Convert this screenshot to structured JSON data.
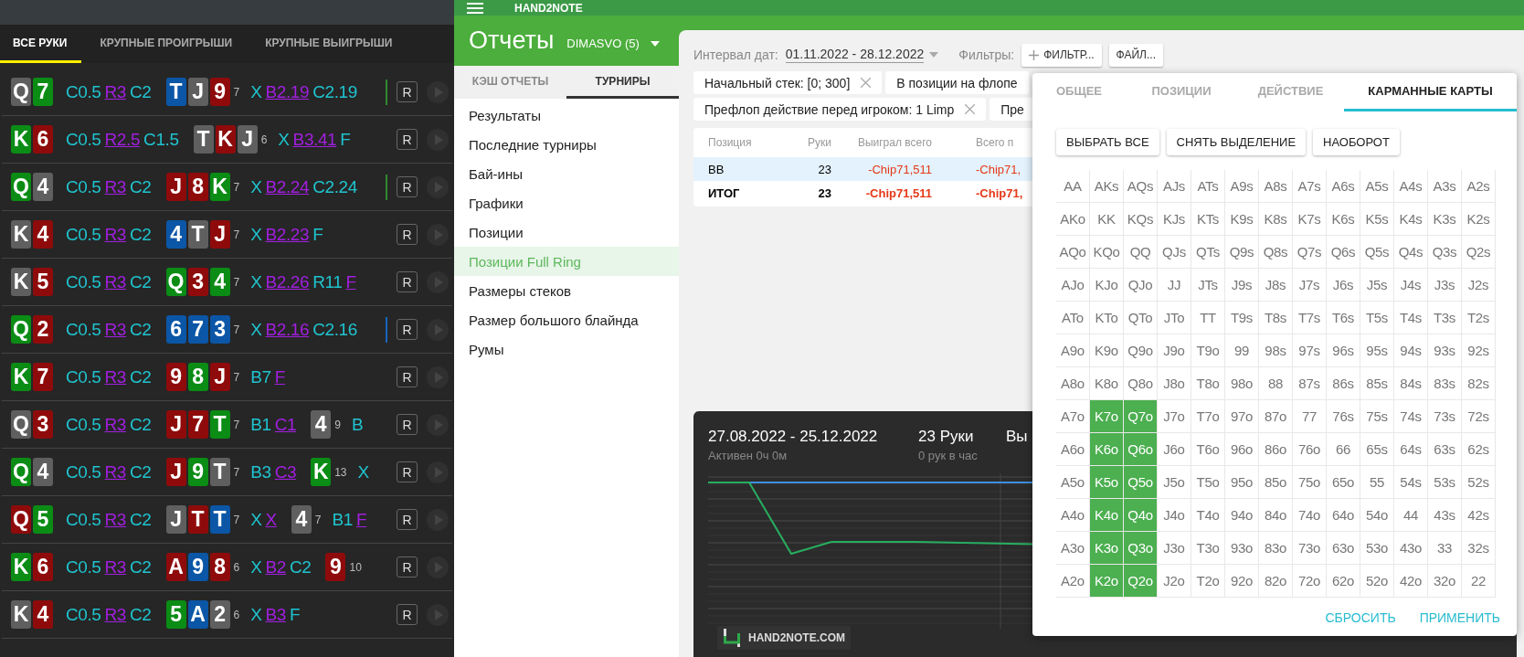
{
  "hands_panel": {
    "tabs": [
      {
        "label": "ВСЕ РУКИ",
        "selected": true
      },
      {
        "label": "КРУПНЫЕ ПРОИГРЫШИ",
        "selected": false
      },
      {
        "label": "КРУПНЫЕ ВЫИГРЫШИ",
        "selected": false
      }
    ],
    "hands": [
      {
        "hole": [
          {
            "rank": "Q",
            "color": "#5f5f5f"
          },
          {
            "rank": "7",
            "color": "#0b8c15"
          }
        ],
        "preflop": [
          {
            "text": "C0.5",
            "hero": false
          },
          {
            "text": "R3",
            "hero": true
          },
          {
            "text": "C2",
            "hero": false
          }
        ],
        "streets": [
          {
            "cards": [
              {
                "rank": "T",
                "color": "#0b56a6"
              },
              {
                "rank": "J",
                "color": "#5f5f5f"
              },
              {
                "rank": "9",
                "color": "#8f0b0b"
              }
            ],
            "pot": "7",
            "actions": [
              {
                "text": "X",
                "hero": false
              },
              {
                "text": "B2.19",
                "hero": true
              },
              {
                "text": "C2.19",
                "hero": false
              }
            ]
          }
        ],
        "marker": {
          "color": "#2e8b2e"
        },
        "replay": "R"
      },
      {
        "hole": [
          {
            "rank": "K",
            "color": "#0b8c15"
          },
          {
            "rank": "6",
            "color": "#8f0b0b"
          }
        ],
        "preflop": [
          {
            "text": "C0.5",
            "hero": false
          },
          {
            "text": "R2.5",
            "hero": true
          },
          {
            "text": "C1.5",
            "hero": false
          }
        ],
        "streets": [
          {
            "cards": [
              {
                "rank": "T",
                "color": "#5f5f5f"
              },
              {
                "rank": "K",
                "color": "#8f0b0b"
              },
              {
                "rank": "J",
                "color": "#5f5f5f"
              }
            ],
            "pot": "6",
            "actions": [
              {
                "text": "X",
                "hero": false
              },
              {
                "text": "B3.41",
                "hero": true
              },
              {
                "text": "F",
                "hero": false
              }
            ]
          }
        ],
        "replay": "R"
      },
      {
        "hole": [
          {
            "rank": "Q",
            "color": "#0b8c15"
          },
          {
            "rank": "4",
            "color": "#5f5f5f"
          }
        ],
        "preflop": [
          {
            "text": "C0.5",
            "hero": false
          },
          {
            "text": "R3",
            "hero": true
          },
          {
            "text": "C2",
            "hero": false
          }
        ],
        "streets": [
          {
            "cards": [
              {
                "rank": "J",
                "color": "#8f0b0b"
              },
              {
                "rank": "8",
                "color": "#8f0b0b"
              },
              {
                "rank": "K",
                "color": "#0b8c15"
              }
            ],
            "pot": "7",
            "actions": [
              {
                "text": "X",
                "hero": false
              },
              {
                "text": "B2.24",
                "hero": true
              },
              {
                "text": "C2.24",
                "hero": false
              }
            ]
          }
        ],
        "marker": {
          "color": "#2e8b2e"
        },
        "replay": "R"
      },
      {
        "hole": [
          {
            "rank": "K",
            "color": "#5f5f5f"
          },
          {
            "rank": "4",
            "color": "#8f0b0b"
          }
        ],
        "preflop": [
          {
            "text": "C0.5",
            "hero": false
          },
          {
            "text": "R3",
            "hero": true
          },
          {
            "text": "C2",
            "hero": false
          }
        ],
        "streets": [
          {
            "cards": [
              {
                "rank": "4",
                "color": "#0b56a6"
              },
              {
                "rank": "T",
                "color": "#5f5f5f"
              },
              {
                "rank": "J",
                "color": "#8f0b0b"
              }
            ],
            "pot": "7",
            "actions": [
              {
                "text": "X",
                "hero": false
              },
              {
                "text": "B2.23",
                "hero": true
              },
              {
                "text": "F",
                "hero": false
              }
            ]
          }
        ],
        "replay": "R"
      },
      {
        "hole": [
          {
            "rank": "K",
            "color": "#5f5f5f"
          },
          {
            "rank": "5",
            "color": "#8f0b0b"
          }
        ],
        "preflop": [
          {
            "text": "C0.5",
            "hero": false
          },
          {
            "text": "R3",
            "hero": true
          },
          {
            "text": "C2",
            "hero": false
          }
        ],
        "streets": [
          {
            "cards": [
              {
                "rank": "Q",
                "color": "#0b8c15"
              },
              {
                "rank": "3",
                "color": "#8f0b0b"
              },
              {
                "rank": "4",
                "color": "#0b8c15"
              }
            ],
            "pot": "7",
            "actions": [
              {
                "text": "X",
                "hero": false
              },
              {
                "text": "B2.26",
                "hero": true
              },
              {
                "text": "R11",
                "hero": false
              },
              {
                "text": "F",
                "hero": true
              }
            ]
          }
        ],
        "replay": "R"
      },
      {
        "hole": [
          {
            "rank": "Q",
            "color": "#0b8c15"
          },
          {
            "rank": "2",
            "color": "#8f0b0b"
          }
        ],
        "preflop": [
          {
            "text": "C0.5",
            "hero": false
          },
          {
            "text": "R3",
            "hero": true
          },
          {
            "text": "C2",
            "hero": false
          }
        ],
        "streets": [
          {
            "cards": [
              {
                "rank": "6",
                "color": "#0b56a6"
              },
              {
                "rank": "7",
                "color": "#0b56a6"
              },
              {
                "rank": "3",
                "color": "#0b56a6"
              }
            ],
            "pot": "7",
            "actions": [
              {
                "text": "X",
                "hero": false
              },
              {
                "text": "B2.16",
                "hero": true
              },
              {
                "text": "C2.16",
                "hero": false
              }
            ]
          }
        ],
        "marker": {
          "color": "#1565c0"
        },
        "replay": "R"
      },
      {
        "hole": [
          {
            "rank": "K",
            "color": "#0b8c15"
          },
          {
            "rank": "7",
            "color": "#8f0b0b"
          }
        ],
        "preflop": [
          {
            "text": "C0.5",
            "hero": false
          },
          {
            "text": "R3",
            "hero": true
          },
          {
            "text": "C2",
            "hero": false
          }
        ],
        "streets": [
          {
            "cards": [
              {
                "rank": "9",
                "color": "#8f0b0b"
              },
              {
                "rank": "8",
                "color": "#0b8c15"
              },
              {
                "rank": "J",
                "color": "#8f0b0b"
              }
            ],
            "pot": "7",
            "actions": [
              {
                "text": "B7",
                "hero": false
              },
              {
                "text": "F",
                "hero": true
              }
            ]
          }
        ],
        "replay": "R"
      },
      {
        "hole": [
          {
            "rank": "Q",
            "color": "#5f5f5f"
          },
          {
            "rank": "3",
            "color": "#8f0b0b"
          }
        ],
        "preflop": [
          {
            "text": "C0.5",
            "hero": false
          },
          {
            "text": "R3",
            "hero": true
          },
          {
            "text": "C2",
            "hero": false
          }
        ],
        "streets": [
          {
            "cards": [
              {
                "rank": "J",
                "color": "#8f0b0b"
              },
              {
                "rank": "7",
                "color": "#8f0b0b"
              },
              {
                "rank": "T",
                "color": "#0b8c15"
              }
            ],
            "pot": "7",
            "actions": [
              {
                "text": "B1",
                "hero": false
              },
              {
                "text": "C1",
                "hero": true
              }
            ]
          },
          {
            "cards": [
              {
                "rank": "4",
                "color": "#5f5f5f"
              }
            ],
            "pot": "9",
            "actions": [
              {
                "text": "B",
                "hero": false
              }
            ]
          }
        ],
        "replay": "R"
      },
      {
        "hole": [
          {
            "rank": "Q",
            "color": "#0b8c15"
          },
          {
            "rank": "4",
            "color": "#5f5f5f"
          }
        ],
        "preflop": [
          {
            "text": "C0.5",
            "hero": false
          },
          {
            "text": "R3",
            "hero": true
          },
          {
            "text": "C2",
            "hero": false
          }
        ],
        "streets": [
          {
            "cards": [
              {
                "rank": "J",
                "color": "#8f0b0b"
              },
              {
                "rank": "9",
                "color": "#0b8c15"
              },
              {
                "rank": "T",
                "color": "#5f5f5f"
              }
            ],
            "pot": "7",
            "actions": [
              {
                "text": "B3",
                "hero": false
              },
              {
                "text": "C3",
                "hero": true
              }
            ]
          },
          {
            "cards": [
              {
                "rank": "K",
                "color": "#0b8c15"
              }
            ],
            "pot": "13",
            "actions": [
              {
                "text": "X",
                "hero": false
              }
            ]
          }
        ],
        "replay": "R"
      },
      {
        "hole": [
          {
            "rank": "Q",
            "color": "#8f0b0b"
          },
          {
            "rank": "5",
            "color": "#0b8c15"
          }
        ],
        "preflop": [
          {
            "text": "C0.5",
            "hero": false
          },
          {
            "text": "R3",
            "hero": true
          },
          {
            "text": "C2",
            "hero": false
          }
        ],
        "streets": [
          {
            "cards": [
              {
                "rank": "J",
                "color": "#5f5f5f"
              },
              {
                "rank": "T",
                "color": "#8f0b0b"
              },
              {
                "rank": "T",
                "color": "#0b56a6"
              }
            ],
            "pot": "7",
            "actions": [
              {
                "text": "X",
                "hero": false
              },
              {
                "text": "X",
                "hero": true
              }
            ]
          },
          {
            "cards": [
              {
                "rank": "4",
                "color": "#5f5f5f"
              }
            ],
            "pot": "7",
            "actions": [
              {
                "text": "B1",
                "hero": false
              },
              {
                "text": "F",
                "hero": true
              }
            ]
          }
        ],
        "replay": "R"
      },
      {
        "hole": [
          {
            "rank": "K",
            "color": "#0b8c15"
          },
          {
            "rank": "6",
            "color": "#8f0b0b"
          }
        ],
        "preflop": [
          {
            "text": "C0.5",
            "hero": false
          },
          {
            "text": "R3",
            "hero": true
          },
          {
            "text": "C2",
            "hero": false
          }
        ],
        "streets": [
          {
            "cards": [
              {
                "rank": "A",
                "color": "#8f0b0b"
              },
              {
                "rank": "9",
                "color": "#0b56a6"
              },
              {
                "rank": "8",
                "color": "#8f0b0b"
              }
            ],
            "pot": "6",
            "actions": [
              {
                "text": "X",
                "hero": false
              },
              {
                "text": "B2",
                "hero": true
              },
              {
                "text": "C2",
                "hero": false
              }
            ]
          },
          {
            "cards": [
              {
                "rank": "9",
                "color": "#8f0b0b"
              }
            ],
            "pot": "10"
          }
        ],
        "replay": "R"
      },
      {
        "hole": [
          {
            "rank": "K",
            "color": "#5f5f5f"
          },
          {
            "rank": "4",
            "color": "#8f0b0b"
          }
        ],
        "preflop": [
          {
            "text": "C0.5",
            "hero": false
          },
          {
            "text": "R3",
            "hero": true
          },
          {
            "text": "C2",
            "hero": false
          }
        ],
        "streets": [
          {
            "cards": [
              {
                "rank": "5",
                "color": "#0b8c15"
              },
              {
                "rank": "A",
                "color": "#0b56a6"
              },
              {
                "rank": "2",
                "color": "#5f5f5f"
              }
            ],
            "pot": "6",
            "actions": [
              {
                "text": "X",
                "hero": false
              },
              {
                "text": "B3",
                "hero": true
              },
              {
                "text": "F",
                "hero": false
              }
            ]
          }
        ],
        "replay": "R"
      }
    ]
  },
  "app": {
    "brand": "HAND2NOTE",
    "title": "Отчеты",
    "profile": "DIMASVO (5)",
    "nav_tabs": [
      {
        "label": "КЭШ ОТЧЕТЫ",
        "selected": false
      },
      {
        "label": "ТУРНИРЫ",
        "selected": true
      }
    ],
    "nav_items": [
      {
        "label": "Результаты",
        "selected": false
      },
      {
        "label": "Последние турниры",
        "selected": false
      },
      {
        "label": "Бай-ины",
        "selected": false
      },
      {
        "label": "Графики",
        "selected": false
      },
      {
        "label": "Позиции",
        "selected": false
      },
      {
        "label": "Позиции Full Ring",
        "selected": true
      },
      {
        "label": "Размеры стеков",
        "selected": false
      },
      {
        "label": "Размер большого блайнда",
        "selected": false
      },
      {
        "label": "Румы",
        "selected": false
      }
    ],
    "date_label": "Интервал дат:",
    "date_range": "01.11.2022 - 28.12.2022",
    "filters_label": "Фильтры:",
    "filter_button": "ФИЛЬТР...",
    "file_button": "ФАЙЛ...",
    "chip_rows": [
      [
        {
          "text": "Начальный стек: [0; 300]",
          "removable": true
        },
        {
          "text": "В позиции на флопе",
          "removable": false
        }
      ],
      [
        {
          "text": "Префлоп действие перед игроком: 1 Limp",
          "removable": true
        },
        {
          "text": "Пре",
          "removable": false
        }
      ]
    ],
    "table": {
      "columns": [
        "Позиция",
        "Руки",
        "Выиграл всего",
        "Всего п"
      ],
      "rows": [
        {
          "kind": "row",
          "selected": true,
          "cells": [
            "BB",
            "23",
            "-Chip71,511",
            "-Chip71,"
          ]
        },
        {
          "kind": "total",
          "selected": false,
          "cells": [
            "ИТОГ",
            "23",
            "-Chip71,511",
            "-Chip71,"
          ]
        }
      ]
    },
    "summary": {
      "stats": [
        {
          "title": "27.08.2022 - 25.12.2022",
          "subtitle": "Активен 0ч 0м"
        },
        {
          "title": "23 Руки",
          "subtitle": "0 рук в час"
        },
        {
          "title": "Вы"
        }
      ],
      "logo_text": "HAND2NOTE.COM"
    }
  },
  "hand_filter": {
    "tabs": [
      {
        "label": "ОБЩЕЕ",
        "selected": false
      },
      {
        "label": "ПОЗИЦИИ",
        "selected": false
      },
      {
        "label": "ДЕЙСТВИЕ",
        "selected": false
      },
      {
        "label": "КАРМАННЫЕ КАРТЫ",
        "selected": true
      }
    ],
    "actions": [
      "ВЫБРАТЬ ВСЕ",
      "СНЯТЬ ВЫДЕЛЕНИЕ",
      "НАОБОРОТ"
    ],
    "grid": [
      [
        {
          "label": "AA",
          "selected": false
        },
        {
          "label": "AKs",
          "selected": false
        },
        {
          "label": "AQs",
          "selected": false
        },
        {
          "label": "AJs",
          "selected": false
        },
        {
          "label": "ATs",
          "selected": false
        },
        {
          "label": "A9s",
          "selected": false
        },
        {
          "label": "A8s",
          "selected": false
        },
        {
          "label": "A7s",
          "selected": false
        },
        {
          "label": "A6s",
          "selected": false
        },
        {
          "label": "A5s",
          "selected": false
        },
        {
          "label": "A4s",
          "selected": false
        },
        {
          "label": "A3s",
          "selected": false
        },
        {
          "label": "A2s",
          "selected": false
        }
      ],
      [
        {
          "label": "AKo",
          "selected": false
        },
        {
          "label": "KK",
          "selected": false
        },
        {
          "label": "KQs",
          "selected": false
        },
        {
          "label": "KJs",
          "selected": false
        },
        {
          "label": "KTs",
          "selected": false
        },
        {
          "label": "K9s",
          "selected": false
        },
        {
          "label": "K8s",
          "selected": false
        },
        {
          "label": "K7s",
          "selected": false
        },
        {
          "label": "K6s",
          "selected": false
        },
        {
          "label": "K5s",
          "selected": false
        },
        {
          "label": "K4s",
          "selected": false
        },
        {
          "label": "K3s",
          "selected": false
        },
        {
          "label": "K2s",
          "selected": false
        }
      ],
      [
        {
          "label": "AQo",
          "selected": false
        },
        {
          "label": "KQo",
          "selected": false
        },
        {
          "label": "QQ",
          "selected": false
        },
        {
          "label": "QJs",
          "selected": false
        },
        {
          "label": "QTs",
          "selected": false
        },
        {
          "label": "Q9s",
          "selected": false
        },
        {
          "label": "Q8s",
          "selected": false
        },
        {
          "label": "Q7s",
          "selected": false
        },
        {
          "label": "Q6s",
          "selected": false
        },
        {
          "label": "Q5s",
          "selected": false
        },
        {
          "label": "Q4s",
          "selected": false
        },
        {
          "label": "Q3s",
          "selected": false
        },
        {
          "label": "Q2s",
          "selected": false
        }
      ],
      [
        {
          "label": "AJo",
          "selected": false
        },
        {
          "label": "KJo",
          "selected": false
        },
        {
          "label": "QJo",
          "selected": false
        },
        {
          "label": "JJ",
          "selected": false
        },
        {
          "label": "JTs",
          "selected": false
        },
        {
          "label": "J9s",
          "selected": false
        },
        {
          "label": "J8s",
          "selected": false
        },
        {
          "label": "J7s",
          "selected": false
        },
        {
          "label": "J6s",
          "selected": false
        },
        {
          "label": "J5s",
          "selected": false
        },
        {
          "label": "J4s",
          "selected": false
        },
        {
          "label": "J3s",
          "selected": false
        },
        {
          "label": "J2s",
          "selected": false
        }
      ],
      [
        {
          "label": "ATo",
          "selected": false
        },
        {
          "label": "KTo",
          "selected": false
        },
        {
          "label": "QTo",
          "selected": false
        },
        {
          "label": "JTo",
          "selected": false
        },
        {
          "label": "TT",
          "selected": false
        },
        {
          "label": "T9s",
          "selected": false
        },
        {
          "label": "T8s",
          "selected": false
        },
        {
          "label": "T7s",
          "selected": false
        },
        {
          "label": "T6s",
          "selected": false
        },
        {
          "label": "T5s",
          "selected": false
        },
        {
          "label": "T4s",
          "selected": false
        },
        {
          "label": "T3s",
          "selected": false
        },
        {
          "label": "T2s",
          "selected": false
        }
      ],
      [
        {
          "label": "A9o",
          "selected": false
        },
        {
          "label": "K9o",
          "selected": false
        },
        {
          "label": "Q9o",
          "selected": false
        },
        {
          "label": "J9o",
          "selected": false
        },
        {
          "label": "T9o",
          "selected": false
        },
        {
          "label": "99",
          "selected": false
        },
        {
          "label": "98s",
          "selected": false
        },
        {
          "label": "97s",
          "selected": false
        },
        {
          "label": "96s",
          "selected": false
        },
        {
          "label": "95s",
          "selected": false
        },
        {
          "label": "94s",
          "selected": false
        },
        {
          "label": "93s",
          "selected": false
        },
        {
          "label": "92s",
          "selected": false
        }
      ],
      [
        {
          "label": "A8o",
          "selected": false
        },
        {
          "label": "K8o",
          "selected": false
        },
        {
          "label": "Q8o",
          "selected": false
        },
        {
          "label": "J8o",
          "selected": false
        },
        {
          "label": "T8o",
          "selected": false
        },
        {
          "label": "98o",
          "selected": false
        },
        {
          "label": "88",
          "selected": false
        },
        {
          "label": "87s",
          "selected": false
        },
        {
          "label": "86s",
          "selected": false
        },
        {
          "label": "85s",
          "selected": false
        },
        {
          "label": "84s",
          "selected": false
        },
        {
          "label": "83s",
          "selected": false
        },
        {
          "label": "82s",
          "selected": false
        }
      ],
      [
        {
          "label": "A7o",
          "selected": false
        },
        {
          "label": "K7o",
          "selected": true
        },
        {
          "label": "Q7o",
          "selected": true
        },
        {
          "label": "J7o",
          "selected": false
        },
        {
          "label": "T7o",
          "selected": false
        },
        {
          "label": "97o",
          "selected": false
        },
        {
          "label": "87o",
          "selected": false
        },
        {
          "label": "77",
          "selected": false
        },
        {
          "label": "76s",
          "selected": false
        },
        {
          "label": "75s",
          "selected": false
        },
        {
          "label": "74s",
          "selected": false
        },
        {
          "label": "73s",
          "selected": false
        },
        {
          "label": "72s",
          "selected": false
        }
      ],
      [
        {
          "label": "A6o",
          "selected": false
        },
        {
          "label": "K6o",
          "selected": true
        },
        {
          "label": "Q6o",
          "selected": true
        },
        {
          "label": "J6o",
          "selected": false
        },
        {
          "label": "T6o",
          "selected": false
        },
        {
          "label": "96o",
          "selected": false
        },
        {
          "label": "86o",
          "selected": false
        },
        {
          "label": "76o",
          "selected": false
        },
        {
          "label": "66",
          "selected": false
        },
        {
          "label": "65s",
          "selected": false
        },
        {
          "label": "64s",
          "selected": false
        },
        {
          "label": "63s",
          "selected": false
        },
        {
          "label": "62s",
          "selected": false
        }
      ],
      [
        {
          "label": "A5o",
          "selected": false
        },
        {
          "label": "K5o",
          "selected": true
        },
        {
          "label": "Q5o",
          "selected": true
        },
        {
          "label": "J5o",
          "selected": false
        },
        {
          "label": "T5o",
          "selected": false
        },
        {
          "label": "95o",
          "selected": false
        },
        {
          "label": "85o",
          "selected": false
        },
        {
          "label": "75o",
          "selected": false
        },
        {
          "label": "65o",
          "selected": false
        },
        {
          "label": "55",
          "selected": false
        },
        {
          "label": "54s",
          "selected": false
        },
        {
          "label": "53s",
          "selected": false
        },
        {
          "label": "52s",
          "selected": false
        }
      ],
      [
        {
          "label": "A4o",
          "selected": false
        },
        {
          "label": "K4o",
          "selected": true
        },
        {
          "label": "Q4o",
          "selected": true
        },
        {
          "label": "J4o",
          "selected": false
        },
        {
          "label": "T4o",
          "selected": false
        },
        {
          "label": "94o",
          "selected": false
        },
        {
          "label": "84o",
          "selected": false
        },
        {
          "label": "74o",
          "selected": false
        },
        {
          "label": "64o",
          "selected": false
        },
        {
          "label": "54o",
          "selected": false
        },
        {
          "label": "44",
          "selected": false
        },
        {
          "label": "43s",
          "selected": false
        },
        {
          "label": "42s",
          "selected": false
        }
      ],
      [
        {
          "label": "A3o",
          "selected": false
        },
        {
          "label": "K3o",
          "selected": true
        },
        {
          "label": "Q3o",
          "selected": true
        },
        {
          "label": "J3o",
          "selected": false
        },
        {
          "label": "T3o",
          "selected": false
        },
        {
          "label": "93o",
          "selected": false
        },
        {
          "label": "83o",
          "selected": false
        },
        {
          "label": "73o",
          "selected": false
        },
        {
          "label": "63o",
          "selected": false
        },
        {
          "label": "53o",
          "selected": false
        },
        {
          "label": "43o",
          "selected": false
        },
        {
          "label": "33",
          "selected": false
        },
        {
          "label": "32s",
          "selected": false
        }
      ],
      [
        {
          "label": "A2o",
          "selected": false
        },
        {
          "label": "K2o",
          "selected": true
        },
        {
          "label": "Q2o",
          "selected": true
        },
        {
          "label": "J2o",
          "selected": false
        },
        {
          "label": "T2o",
          "selected": false
        },
        {
          "label": "92o",
          "selected": false
        },
        {
          "label": "82o",
          "selected": false
        },
        {
          "label": "72o",
          "selected": false
        },
        {
          "label": "62o",
          "selected": false
        },
        {
          "label": "52o",
          "selected": false
        },
        {
          "label": "42o",
          "selected": false
        },
        {
          "label": "32o",
          "selected": false
        },
        {
          "label": "22",
          "selected": false
        }
      ]
    ],
    "footer": [
      "СБРОСИТЬ",
      "ПРИМЕНИТЬ"
    ]
  }
}
